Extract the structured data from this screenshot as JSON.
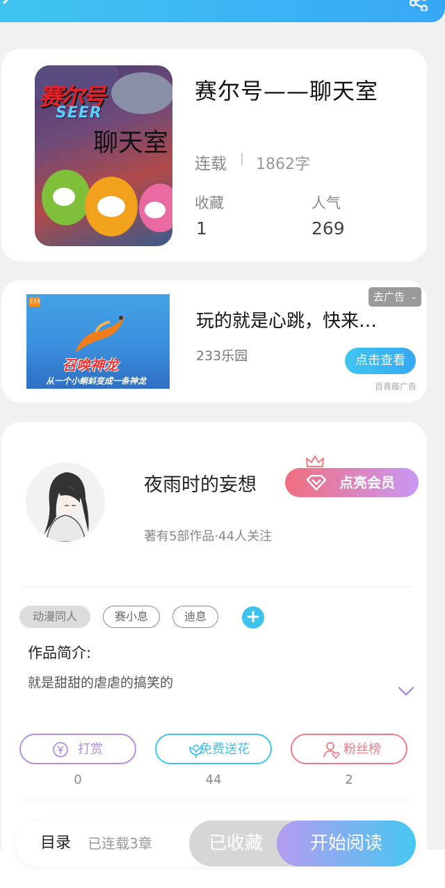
{
  "header": {
    "back_icon": "chevron-left-icon",
    "share_icon": "share-icon"
  },
  "book": {
    "title": "赛尔号——聊天室",
    "cover": {
      "title_text": "赛尔号",
      "seer_text": "SEER",
      "subtitle_text": "聊天室"
    },
    "status": "连载",
    "word_count": "1862字",
    "favorites_label": "收藏",
    "favorites_value": "1",
    "popularity_label": "人气",
    "popularity_value": "269"
  },
  "ad": {
    "badge": "233",
    "image_title": "召唤神龙",
    "image_subtitle": "从一个小蝌蚪变成一条神龙",
    "title": "玩的就是心跳，快来…",
    "source": "233乐园",
    "remove_label": "去广告",
    "view_button": "点击查看",
    "tag": "百青藤广告"
  },
  "author": {
    "name": "夜雨时的妄想",
    "vip_button": "点亮会员",
    "meta": "著有5部作品·44人关注"
  },
  "tags": [
    "动漫同人",
    "赛小息",
    "迪息"
  ],
  "intro": {
    "label": "作品简介:",
    "text": "就是甜甜的虐虐的搞笑的"
  },
  "actions": [
    {
      "label": "打赏",
      "count": "0",
      "icon": "yen-coin-icon",
      "color": "#b08ee8"
    },
    {
      "label": "免费送花",
      "count": "44",
      "icon": "flower-icon",
      "color": "#3cc4ee"
    },
    {
      "label": "粉丝榜",
      "count": "2",
      "icon": "fans-rank-icon",
      "color": "#f07a84"
    }
  ],
  "bottom": {
    "toc_label": "目录",
    "chapters": "已连载3章",
    "favorited_button": "已收藏",
    "read_button": "开始阅读"
  }
}
